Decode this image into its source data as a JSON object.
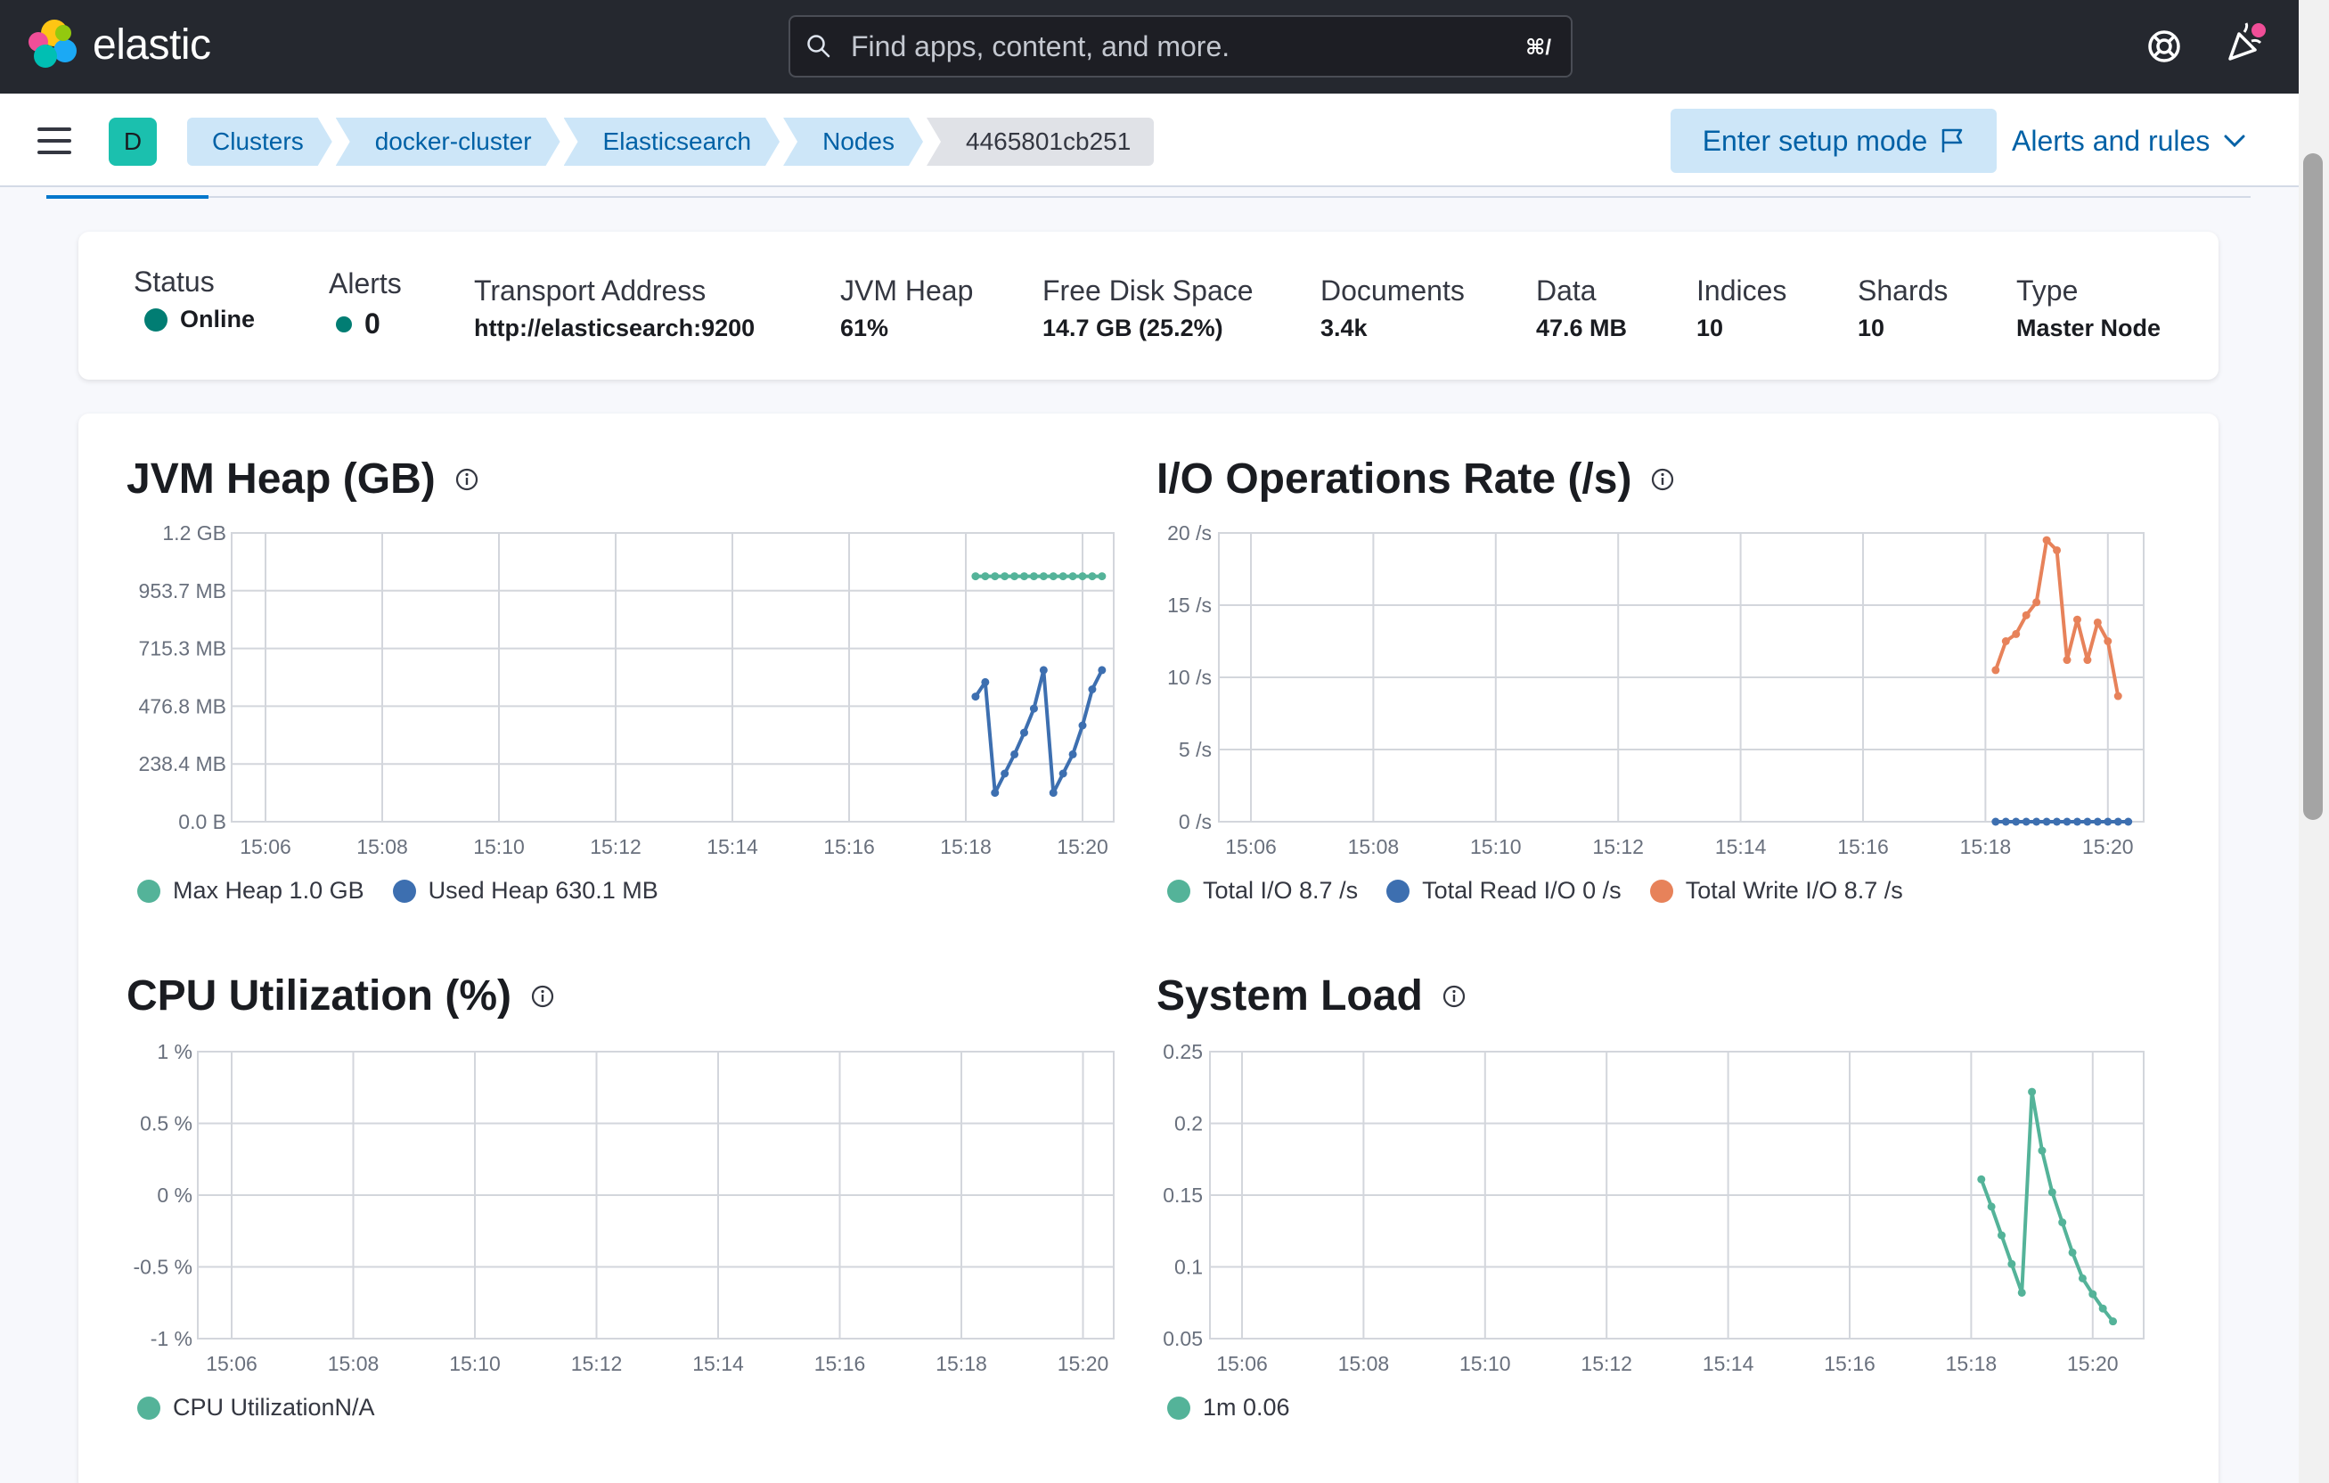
{
  "header": {
    "logo_text": "elastic",
    "search_placeholder": "Find apps, content, and more.",
    "search_shortcut": "⌘/"
  },
  "nav": {
    "space_initial": "D",
    "breadcrumbs": [
      "Clusters",
      "docker-cluster",
      "Elasticsearch",
      "Nodes",
      "4465801cb251"
    ],
    "setup_mode_label": "Enter setup mode",
    "alerts_label": "Alerts and rules"
  },
  "summary": {
    "status_label": "Status",
    "status_value": "Online",
    "alerts_label": "Alerts",
    "alerts_value": "0",
    "transport_label": "Transport Address",
    "transport_value": "http://elasticsearch:9200",
    "jvm_label": "JVM Heap",
    "jvm_value": "61%",
    "disk_label": "Free Disk Space",
    "disk_value": "14.7 GB (25.2%)",
    "docs_label": "Documents",
    "docs_value": "3.4k",
    "data_label": "Data",
    "data_value": "47.6 MB",
    "indices_label": "Indices",
    "indices_value": "10",
    "shards_label": "Shards",
    "shards_value": "10",
    "type_label": "Type",
    "type_value": "Master Node",
    "status_color": "#017d73"
  },
  "chart_data": [
    {
      "type": "line",
      "title": "JVM Heap (GB)",
      "x_ticks": [
        "15:06",
        "15:08",
        "15:10",
        "15:12",
        "15:14",
        "15:16",
        "15:18",
        "15:20"
      ],
      "y_ticks": [
        "1.2 GB",
        "953.7 MB",
        "715.3 MB",
        "476.8 MB",
        "238.4 MB",
        "0.0 B"
      ],
      "ylim": [
        0,
        1.2
      ],
      "grid": true,
      "legend_position": "bottom-left",
      "x": [
        "15:18:10",
        "15:18:20",
        "15:18:30",
        "15:18:40",
        "15:18:50",
        "15:19:00",
        "15:19:10",
        "15:19:20",
        "15:19:30",
        "15:19:40",
        "15:19:50",
        "15:20:00",
        "15:20:10",
        "15:20:20"
      ],
      "series": [
        {
          "name": "Max Heap",
          "legend_label": "Max Heap 1.0 GB",
          "color": "#54b399",
          "values": [
            1.02,
            1.02,
            1.02,
            1.02,
            1.02,
            1.02,
            1.02,
            1.02,
            1.02,
            1.02,
            1.02,
            1.02,
            1.02,
            1.02
          ]
        },
        {
          "name": "Used Heap",
          "legend_label": "Used Heap 630.1 MB",
          "color": "#3d6fb0",
          "values": [
            0.52,
            0.58,
            0.12,
            0.2,
            0.28,
            0.37,
            0.47,
            0.63,
            0.12,
            0.2,
            0.28,
            0.4,
            0.55,
            0.63
          ]
        }
      ]
    },
    {
      "type": "line",
      "title": "I/O Operations Rate (/s)",
      "x_ticks": [
        "15:06",
        "15:08",
        "15:10",
        "15:12",
        "15:14",
        "15:16",
        "15:18",
        "15:20"
      ],
      "y_ticks": [
        "20 /s",
        "15 /s",
        "10 /s",
        "5 /s",
        "0 /s"
      ],
      "ylim": [
        0,
        20
      ],
      "grid": true,
      "legend_position": "bottom-left",
      "x": [
        "15:18:10",
        "15:18:20",
        "15:18:30",
        "15:18:40",
        "15:18:50",
        "15:19:00",
        "15:19:10",
        "15:19:20",
        "15:19:30",
        "15:19:40",
        "15:19:50",
        "15:20:00",
        "15:20:10",
        "15:20:20"
      ],
      "series": [
        {
          "name": "Total I/O",
          "legend_label": "Total I/O 8.7 /s",
          "color": "#54b399",
          "values": [
            10.5,
            12.5,
            13,
            14.3,
            15.2,
            19.5,
            18.8,
            11.2,
            14,
            11.2,
            13.8,
            12.5,
            8.7,
            null
          ]
        },
        {
          "name": "Total Read I/O",
          "legend_label": "Total Read I/O 0 /s",
          "color": "#3d6fb0",
          "values": [
            0,
            0,
            0,
            0,
            0,
            0,
            0,
            0,
            0,
            0,
            0,
            0,
            0,
            0
          ]
        },
        {
          "name": "Total Write I/O",
          "legend_label": "Total Write I/O 8.7 /s",
          "color": "#e7825a",
          "values": [
            10.5,
            12.5,
            13,
            14.3,
            15.2,
            19.5,
            18.8,
            11.2,
            14,
            11.2,
            13.8,
            12.5,
            8.7,
            null
          ]
        }
      ]
    },
    {
      "type": "line",
      "title": "CPU Utilization (%)",
      "x_ticks": [
        "15:06",
        "15:08",
        "15:10",
        "15:12",
        "15:14",
        "15:16",
        "15:18",
        "15:20"
      ],
      "y_ticks": [
        "1 %",
        "0.5 %",
        "0 %",
        "-0.5 %",
        "-1 %"
      ],
      "ylim": [
        -1,
        1
      ],
      "grid": true,
      "legend_position": "bottom-left",
      "series": [
        {
          "name": "CPU Utilization",
          "legend_label": "CPU UtilizationN/A",
          "color": "#54b399",
          "values": []
        }
      ]
    },
    {
      "type": "line",
      "title": "System Load",
      "x_ticks": [
        "15:06",
        "15:08",
        "15:10",
        "15:12",
        "15:14",
        "15:16",
        "15:18",
        "15:20"
      ],
      "y_ticks": [
        "0.25",
        "0.2",
        "0.15",
        "0.1",
        "0.05"
      ],
      "ylim": [
        0.05,
        0.25
      ],
      "grid": true,
      "legend_position": "bottom-left",
      "x": [
        "15:18:10",
        "15:18:20",
        "15:18:30",
        "15:18:40",
        "15:18:50",
        "15:19:00",
        "15:19:10",
        "15:19:20",
        "15:19:30",
        "15:19:40",
        "15:19:50",
        "15:20:00",
        "15:20:10",
        "15:20:20"
      ],
      "series": [
        {
          "name": "1m",
          "legend_label": "1m 0.06",
          "color": "#54b399",
          "values": [
            0.161,
            0.142,
            0.122,
            0.102,
            0.082,
            0.222,
            0.181,
            0.152,
            0.131,
            0.11,
            0.092,
            0.081,
            0.071,
            0.062
          ]
        }
      ]
    }
  ]
}
